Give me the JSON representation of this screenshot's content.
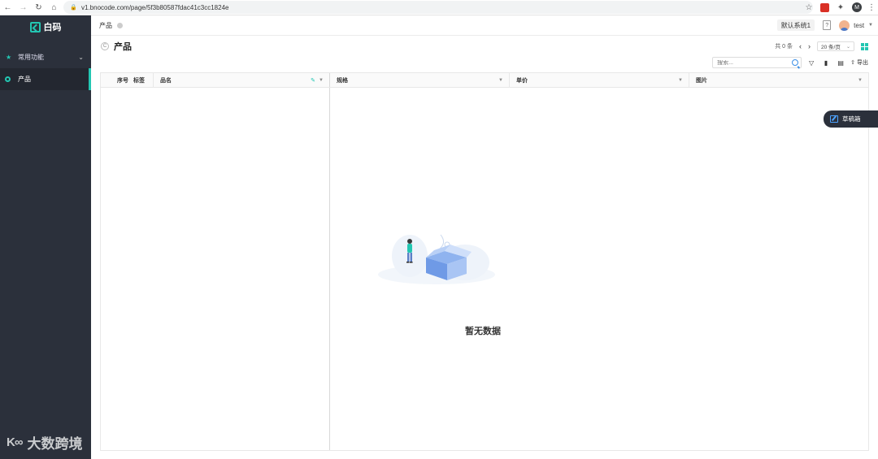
{
  "browser": {
    "url": "v1.bnocode.com/page/5f3b80587fdac41c3cc1824e",
    "profile_initial": "M"
  },
  "sidebar": {
    "logo_text": "白码",
    "group_label": "常用功能",
    "active_item_label": "产品",
    "watermark": "大数跨境"
  },
  "topbar": {
    "tab_label": "产品",
    "system_button": "默认系统1",
    "help_icon": "?",
    "username": "test"
  },
  "page": {
    "title": "产品",
    "pager_count": "共 0 条",
    "page_size": "20 条/页",
    "search_placeholder": "搜索...",
    "export_label": "导出"
  },
  "table": {
    "columns_fixed": [
      "序号",
      "标签",
      "品名"
    ],
    "columns": [
      "规格",
      "单价",
      "图片"
    ],
    "rows": []
  },
  "empty_state": {
    "text": "暂无数据"
  },
  "draft_box": {
    "label": "草稿箱"
  },
  "colors": {
    "accent": "#23c6b2",
    "sidebar_bg": "#2b303b",
    "link_blue": "#3a8ee6"
  },
  "icons": {
    "back": "arrow-left-icon",
    "forward": "arrow-right-icon",
    "reload": "reload-icon",
    "home": "home-icon",
    "star": "star-icon",
    "puzzle": "extensions-icon"
  }
}
